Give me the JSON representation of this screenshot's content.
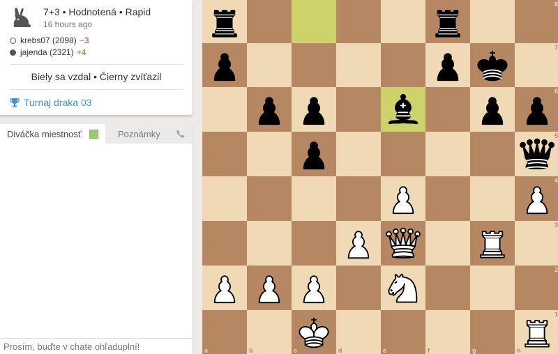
{
  "game": {
    "type": "7+3 • Hodnotená • Rapid",
    "date": "16 hours ago",
    "result": "Biely sa vzdal • Čierny zvíťazil",
    "tournament": "Turnaj draka 03",
    "icon": "rabbit-icon"
  },
  "players": {
    "white": {
      "name": "krebs07 (2098)",
      "diff": "−3"
    },
    "black": {
      "name": "jajenda (2321)",
      "diff": "+4"
    }
  },
  "chat": {
    "tab_spectator": "Diváčka miestnosť",
    "tab_notes": "Poznámky",
    "placeholder": "Prosím, buďte v chate ohľaduplní!"
  },
  "colors": {
    "light_square": "#f0d9b5",
    "dark_square": "#b58863",
    "highlight": "#cdd26a",
    "link": "#3692e7"
  },
  "board": {
    "ranks": [
      "8",
      "7",
      "6",
      "5",
      "4",
      "3",
      "2",
      "1"
    ],
    "files": [
      "a",
      "b",
      "c",
      "d",
      "e",
      "f",
      "g",
      "h"
    ],
    "highlighted_squares": [
      "c8",
      "e6"
    ],
    "pieces": [
      {
        "square": "a8",
        "color": "black",
        "type": "rook"
      },
      {
        "square": "f8",
        "color": "black",
        "type": "rook"
      },
      {
        "square": "a7",
        "color": "black",
        "type": "pawn"
      },
      {
        "square": "f7",
        "color": "black",
        "type": "pawn"
      },
      {
        "square": "g7",
        "color": "black",
        "type": "king"
      },
      {
        "square": "b6",
        "color": "black",
        "type": "pawn"
      },
      {
        "square": "c6",
        "color": "black",
        "type": "pawn"
      },
      {
        "square": "e6",
        "color": "black",
        "type": "bishop"
      },
      {
        "square": "g6",
        "color": "black",
        "type": "pawn"
      },
      {
        "square": "h6",
        "color": "black",
        "type": "pawn"
      },
      {
        "square": "c5",
        "color": "black",
        "type": "pawn"
      },
      {
        "square": "h5",
        "color": "black",
        "type": "queen"
      },
      {
        "square": "e4",
        "color": "white",
        "type": "pawn"
      },
      {
        "square": "h4",
        "color": "white",
        "type": "pawn"
      },
      {
        "square": "d3",
        "color": "white",
        "type": "pawn"
      },
      {
        "square": "e3",
        "color": "white",
        "type": "queen"
      },
      {
        "square": "g3",
        "color": "white",
        "type": "rook"
      },
      {
        "square": "a2",
        "color": "white",
        "type": "pawn"
      },
      {
        "square": "b2",
        "color": "white",
        "type": "pawn"
      },
      {
        "square": "c2",
        "color": "white",
        "type": "pawn"
      },
      {
        "square": "e2",
        "color": "white",
        "type": "knight"
      },
      {
        "square": "c1",
        "color": "white",
        "type": "king"
      },
      {
        "square": "h1",
        "color": "white",
        "type": "rook"
      }
    ]
  }
}
